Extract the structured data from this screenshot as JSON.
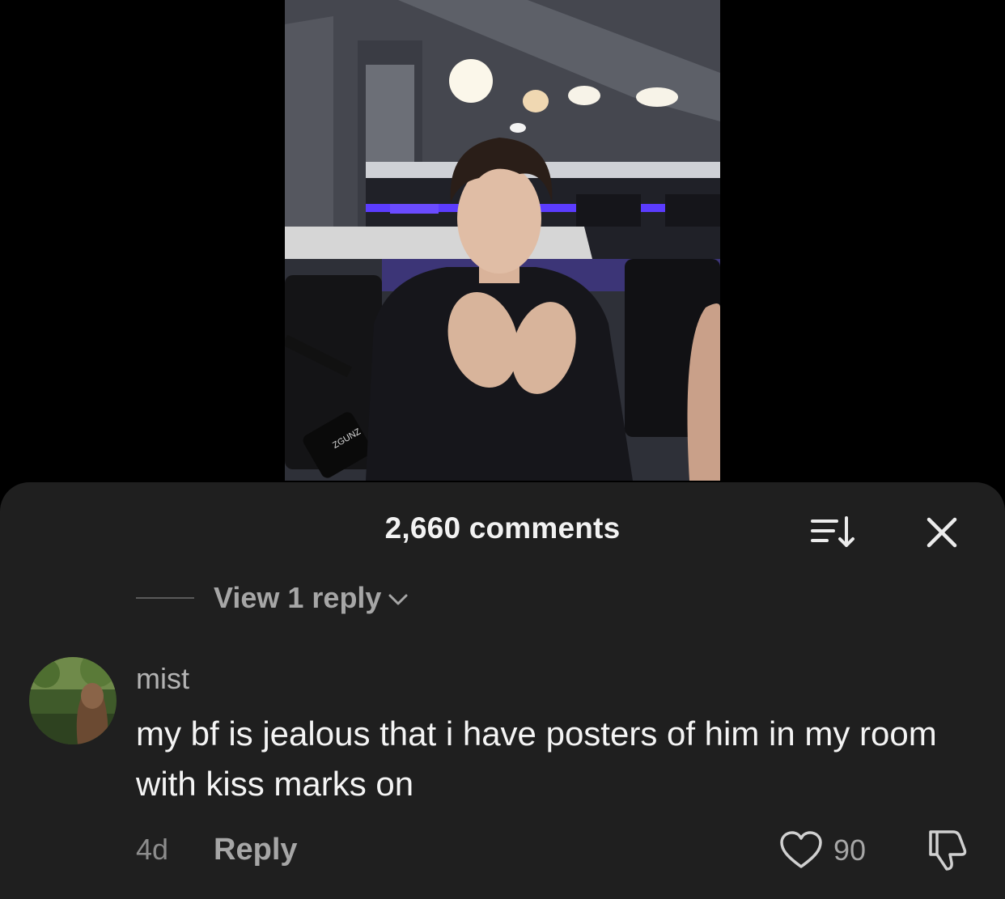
{
  "video": {
    "mic_brand": "ZGUNZ"
  },
  "comments_sheet": {
    "title": "2,660 comments",
    "sort_icon": "sort-icon",
    "close_icon": "close-icon",
    "view_replies_label": "View 1 reply",
    "comment": {
      "username": "mist",
      "text": "my bf is jealous that i have posters of him in my room with kiss marks on",
      "time": "4d",
      "reply_label": "Reply",
      "like_count": "90"
    }
  },
  "colors": {
    "sheet_background": "#1f1f1f",
    "primary_text": "#f4f4f4",
    "secondary_text": "#a6a6a6",
    "accent_led": "#5b3cff"
  }
}
